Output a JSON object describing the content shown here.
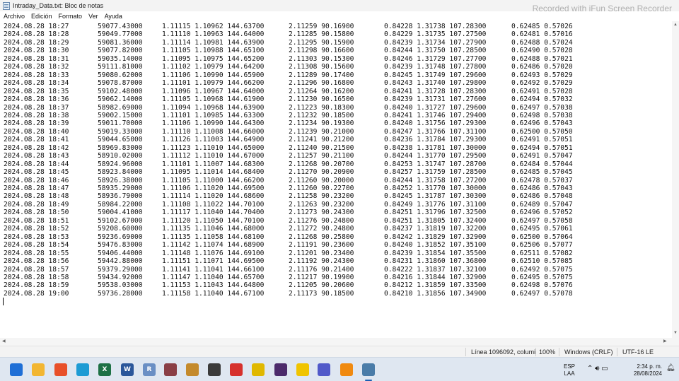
{
  "window": {
    "title": "Intraday_Data.txt: Bloc de notas",
    "watermark": "Recorded with iFun Screen Recorder"
  },
  "menu": [
    "Archivo",
    "Edición",
    "Formato",
    "Ver",
    "Ayuda"
  ],
  "rows": [
    [
      "2024.08.28 18:27",
      "59077.43000",
      "1.11115 1.10962 144.63700",
      "2.11259 90.16900",
      "0.84228 1.31738 107.28300",
      "0.62485 0.57026"
    ],
    [
      "2024.08.28 18:28",
      "59049.77000",
      "1.11110 1.10963 144.64000",
      "2.11285 90.15800",
      "0.84229 1.31735 107.27500",
      "0.62481 0.57016"
    ],
    [
      "2024.08.28 18:29",
      "59081.36000",
      "1.11114 1.10981 144.63900",
      "2.11295 90.15900",
      "0.84239 1.31734 107.27900",
      "0.62488 0.57024"
    ],
    [
      "2024.08.28 18:30",
      "59077.82000",
      "1.11105 1.10988 144.65100",
      "2.11298 90.16600",
      "0.84244 1.31750 107.28500",
      "0.62490 0.57028"
    ],
    [
      "2024.08.28 18:31",
      "59035.14000",
      "1.11095 1.10975 144.65200",
      "2.11303 90.15300",
      "0.84246 1.31729 107.27700",
      "0.62488 0.57021"
    ],
    [
      "2024.08.28 18:32",
      "59111.81000",
      "1.11102 1.10979 144.64200",
      "2.11308 90.15600",
      "0.84239 1.31748 107.27800",
      "0.62486 0.57020"
    ],
    [
      "2024.08.28 18:33",
      "59080.62000",
      "1.11106 1.10990 144.65900",
      "2.11289 90.17400",
      "0.84245 1.31749 107.29600",
      "0.62493 0.57029"
    ],
    [
      "2024.08.28 18:34",
      "59078.87000",
      "1.11101 1.10979 144.66200",
      "2.11296 90.16800",
      "0.84243 1.31740 107.29800",
      "0.62492 0.57029"
    ],
    [
      "2024.08.28 18:35",
      "59102.48000",
      "1.11096 1.10967 144.64000",
      "2.11264 90.16200",
      "0.84241 1.31728 107.28300",
      "0.62491 0.57028"
    ],
    [
      "2024.08.28 18:36",
      "59062.14000",
      "1.11105 1.10968 144.61900",
      "2.11230 90.16500",
      "0.84239 1.31731 107.27600",
      "0.62494 0.57032"
    ],
    [
      "2024.08.28 18:37",
      "58982.69000",
      "1.11094 1.10968 144.63900",
      "2.11223 90.18300",
      "0.84240 1.31727 107.29600",
      "0.62497 0.57038"
    ],
    [
      "2024.08.28 18:38",
      "59002.15000",
      "1.11101 1.10985 144.63300",
      "2.11232 90.18500",
      "0.84241 1.31746 107.29400",
      "0.62498 0.57038"
    ],
    [
      "2024.08.28 18:39",
      "59011.70000",
      "1.11106 1.10990 144.64300",
      "2.11234 90.19300",
      "0.84240 1.31756 107.29300",
      "0.62496 0.57043"
    ],
    [
      "2024.08.28 18:40",
      "59019.33000",
      "1.11110 1.11008 144.66000",
      "2.11239 90.21000",
      "0.84247 1.31766 107.31100",
      "0.62500 0.57050"
    ],
    [
      "2024.08.28 18:41",
      "59044.65000",
      "1.11126 1.11003 144.64900",
      "2.11241 90.21200",
      "0.84236 1.31784 107.29300",
      "0.62491 0.57051"
    ],
    [
      "2024.08.28 18:42",
      "58969.83000",
      "1.11123 1.11010 144.65000",
      "2.11240 90.21500",
      "0.84238 1.31781 107.30000",
      "0.62494 0.57051"
    ],
    [
      "2024.08.28 18:43",
      "58910.02000",
      "1.11112 1.11010 144.67000",
      "2.11257 90.21100",
      "0.84244 1.31770 107.29500",
      "0.62491 0.57047"
    ],
    [
      "2024.08.28 18:44",
      "58924.96000",
      "1.11101 1.11007 144.68300",
      "2.11268 90.20700",
      "0.84253 1.31747 107.28700",
      "0.62484 0.57044"
    ],
    [
      "2024.08.28 18:45",
      "58923.84000",
      "1.11095 1.11014 144.68400",
      "2.11270 90.20900",
      "0.84257 1.31759 107.28500",
      "0.62485 0.57045"
    ],
    [
      "2024.08.28 18:46",
      "58926.38000",
      "1.11105 1.11000 144.66200",
      "2.11260 90.20000",
      "0.84244 1.31758 107.27200",
      "0.62478 0.57037"
    ],
    [
      "2024.08.28 18:47",
      "58935.29000",
      "1.11106 1.11020 144.69500",
      "2.11260 90.22700",
      "0.84252 1.31770 107.30000",
      "0.62486 0.57043"
    ],
    [
      "2024.08.28 18:48",
      "58936.79000",
      "1.11114 1.11020 144.68600",
      "2.11258 90.23200",
      "0.84245 1.31787 107.30300",
      "0.62486 0.57048"
    ],
    [
      "2024.08.28 18:49",
      "58984.22000",
      "1.11108 1.11022 144.70100",
      "2.11263 90.23200",
      "0.84249 1.31776 107.31100",
      "0.62489 0.57047"
    ],
    [
      "2024.08.28 18:50",
      "59004.41000",
      "1.11117 1.11040 144.70400",
      "2.11273 90.24300",
      "0.84251 1.31796 107.32500",
      "0.62496 0.57052"
    ],
    [
      "2024.08.28 18:51",
      "59102.67000",
      "1.11120 1.11050 144.70100",
      "2.11276 90.24800",
      "0.84251 1.31805 107.32400",
      "0.62497 0.57058"
    ],
    [
      "2024.08.28 18:52",
      "59208.60000",
      "1.11135 1.11046 144.68000",
      "2.11272 90.24800",
      "0.84237 1.31819 107.32200",
      "0.62495 0.57061"
    ],
    [
      "2024.08.28 18:53",
      "59236.69000",
      "1.11135 1.11058 144.68100",
      "2.11268 90.25800",
      "0.84242 1.31829 107.32900",
      "0.62500 0.57064"
    ],
    [
      "2024.08.28 18:54",
      "59476.83000",
      "1.11142 1.11074 144.68900",
      "2.11191 90.23600",
      "0.84240 1.31852 107.35100",
      "0.62506 0.57077"
    ],
    [
      "2024.08.28 18:55",
      "59406.44000",
      "1.11148 1.11076 144.69100",
      "2.11201 90.23400",
      "0.84239 1.31854 107.35500",
      "0.62511 0.57082"
    ],
    [
      "2024.08.28 18:56",
      "59442.88000",
      "1.11151 1.11071 144.69500",
      "2.11192 90.24300",
      "0.84231 1.31860 107.36800",
      "0.62510 0.57085"
    ],
    [
      "2024.08.28 18:57",
      "59379.29000",
      "1.11141 1.11041 144.66100",
      "2.11176 90.21400",
      "0.84222 1.31837 107.32100",
      "0.62492 0.57075"
    ],
    [
      "2024.08.28 18:58",
      "59434.92000",
      "1.11147 1.11040 144.65700",
      "2.11217 90.19900",
      "0.84216 1.31844 107.32900",
      "0.62495 0.57075"
    ],
    [
      "2024.08.28 18:59",
      "59538.03000",
      "1.11153 1.11043 144.64800",
      "2.11205 90.20600",
      "0.84212 1.31859 107.33500",
      "0.62498 0.57076"
    ],
    [
      "2024.08.28 19:00",
      "59736.28000",
      "1.11158 1.11040 144.67100",
      "2.11173 90.18500",
      "0.84210 1.31856 107.34900",
      "0.62497 0.57078"
    ]
  ],
  "status": {
    "position": "Línea 1096092, columi",
    "zoom": "100%",
    "line_ending": "Windows (CRLF)",
    "encoding": "UTF-16 LE"
  },
  "taskbar": {
    "icons": [
      {
        "name": "start-icon",
        "label": "",
        "color": "#1f6fd6"
      },
      {
        "name": "file-explorer-icon",
        "label": "",
        "color": "#f2b632"
      },
      {
        "name": "brave-icon",
        "label": "",
        "color": "#e8502a"
      },
      {
        "name": "edge-icon",
        "label": "",
        "color": "#1d9bd4"
      },
      {
        "name": "excel-icon",
        "label": "X",
        "color": "#1e7145"
      },
      {
        "name": "word-icon",
        "label": "W",
        "color": "#2b579a"
      },
      {
        "name": "r-icon",
        "label": "R",
        "color": "#6a8fc4"
      },
      {
        "name": "app-icon-1",
        "label": "",
        "color": "#8a3f46"
      },
      {
        "name": "app-icon-2",
        "label": "",
        "color": "#c48a2c"
      },
      {
        "name": "app-icon-3",
        "label": "",
        "color": "#3b3b3b"
      },
      {
        "name": "recorder-icon",
        "label": "",
        "color": "#d6312d"
      },
      {
        "name": "app-icon-4",
        "label": "",
        "color": "#e0b800"
      },
      {
        "name": "app-icon-5",
        "label": "",
        "color": "#4b2a6b"
      },
      {
        "name": "app-icon-6",
        "label": "",
        "color": "#f0c400"
      },
      {
        "name": "teams-icon",
        "label": "",
        "color": "#5059c9"
      },
      {
        "name": "vlc-icon",
        "label": "",
        "color": "#f08a10"
      },
      {
        "name": "notepad-icon",
        "label": "",
        "color": "#4a7ca8"
      }
    ],
    "lang_top": "ESP",
    "lang_bottom": "LAA",
    "time": "2:34 p. m.",
    "date": "28/08/2024"
  }
}
